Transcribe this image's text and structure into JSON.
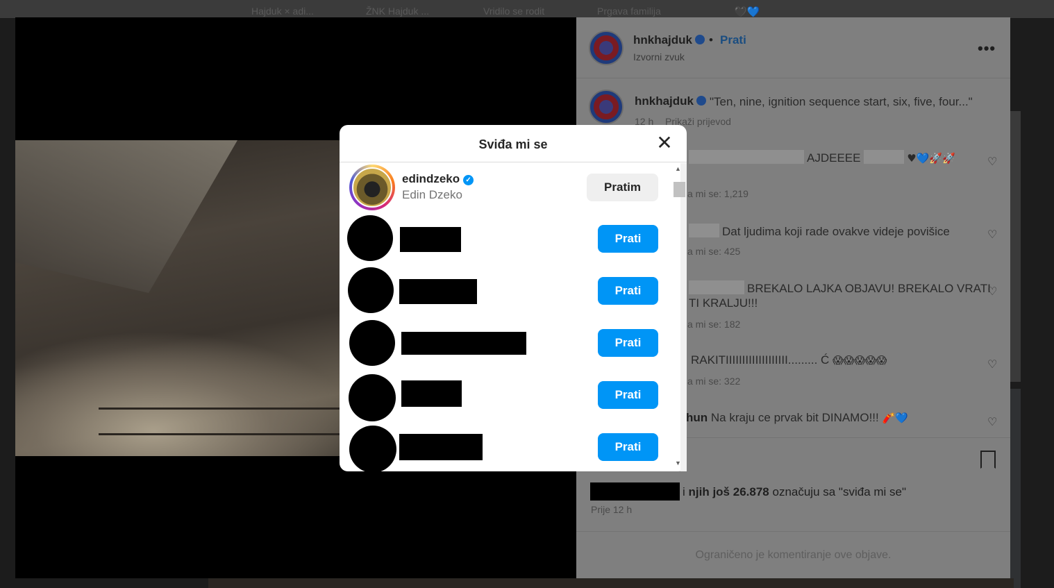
{
  "background_tabs": [
    "Hajduk × adi...",
    "ŽNK Hajduk ...",
    "Vridilo se rodit",
    "Prgava familija",
    "🖤💙"
  ],
  "post": {
    "author": "hnkhajduk",
    "follow_label": "Prati",
    "dot": "•",
    "audio": "Izvorni zvuk",
    "more": "•••",
    "caption_author": "hnkhajduk",
    "caption_text": "\"Ten, nine, ignition sequence start, six, five, four...\"",
    "caption_time": "12 h",
    "translate_label": "Prikaži prijevod",
    "comments": [
      {
        "text": "AJDEEEE",
        "emoji": "♥💙🚀🚀",
        "likes": "a mi se: 1,219"
      },
      {
        "text": "Dat ljudima koji rade ovakve videje povišice",
        "likes": "a mi se: 425"
      },
      {
        "text": "BREKALO LAJKA OBJAVU! BREKALO VRATI",
        "text2": "TI KRALJU!!!",
        "likes": "a mi se: 182"
      },
      {
        "text": "RAKITIIIIIIIIIIIIIIIIIII......... Ć",
        "emoji": "😱😱😱😱😱",
        "likes": "a mi se: 322"
      },
      {
        "user": "hun",
        "text": "Na kraju ce prvak bit DINAMO!!!",
        "emoji": "🧨💙"
      }
    ],
    "likes_text": "i",
    "likes_others": "njih još 26.878",
    "likes_suffix": "označuju sa \"sviđa mi se\"",
    "time_ago": "Prije 12 h",
    "restricted_comments": "Ograničeno je komentiranje ove objave."
  },
  "modal": {
    "title": "Sviđa mi se",
    "close_icon": "close-icon",
    "users": [
      {
        "username": "edindzeko",
        "full_name": "Edin Dzeko",
        "verified": true,
        "button": "Pratim"
      },
      {
        "button": "Prati"
      },
      {
        "button": "Prati"
      },
      {
        "button": "Prati"
      },
      {
        "button": "Prati"
      },
      {
        "button": "Prati"
      }
    ]
  },
  "colors": {
    "follow_blue": "#0095f6",
    "following_gray": "#efefef",
    "overlay": "#7f7f7f"
  }
}
